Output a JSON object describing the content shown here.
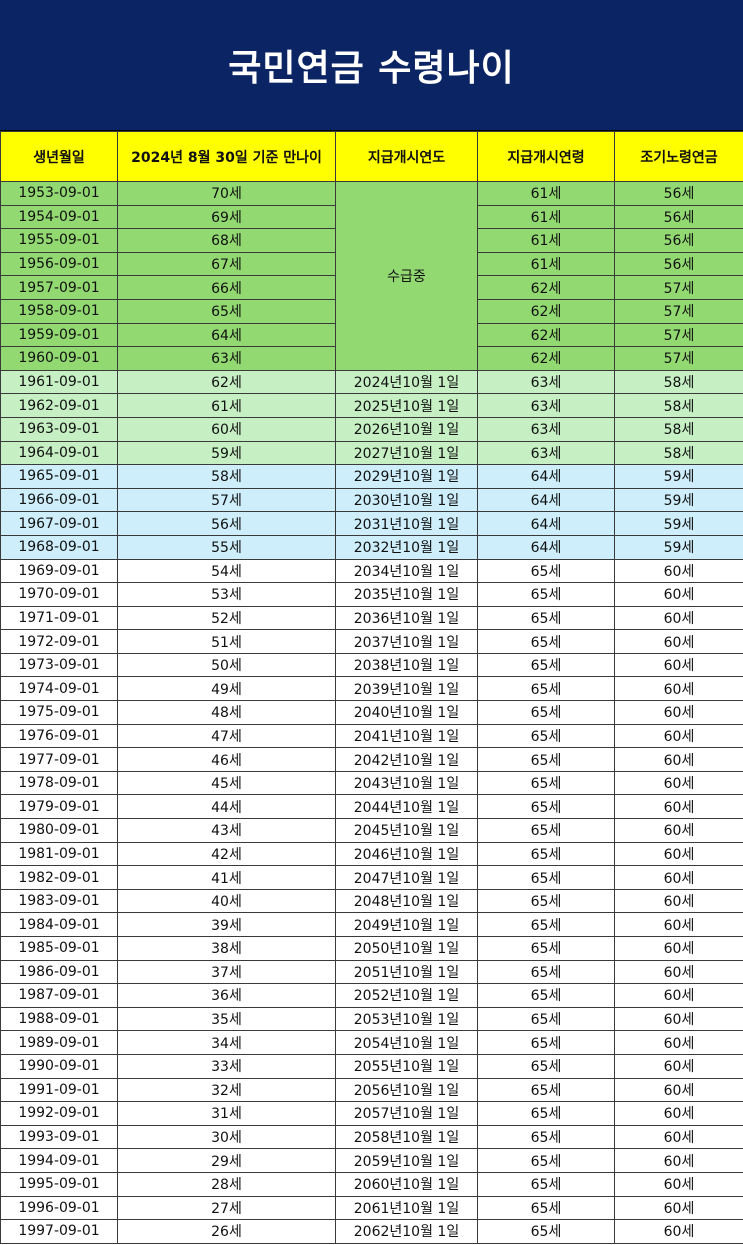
{
  "title": "국민연금 수령나이",
  "colors": {
    "title_bg": "#0b2463",
    "header_bg": "#ffff00",
    "group_receiving": "#92d972",
    "group_63": "#c6efc4",
    "group_64": "#cdeefa",
    "group_65": "#ffffff"
  },
  "table": {
    "headers": [
      "생년월일",
      "2024년 8월 30일 기준 만나이",
      "지급개시연도",
      "지급개시연령",
      "조기노령연금"
    ],
    "merged_status": "수급중",
    "rows": [
      {
        "birth": "1953-09-01",
        "age": "70세",
        "start_year": "",
        "start_age": "61세",
        "early": "56세",
        "group": "g1"
      },
      {
        "birth": "1954-09-01",
        "age": "69세",
        "start_year": "",
        "start_age": "61세",
        "early": "56세",
        "group": "g1"
      },
      {
        "birth": "1955-09-01",
        "age": "68세",
        "start_year": "",
        "start_age": "61세",
        "early": "56세",
        "group": "g1"
      },
      {
        "birth": "1956-09-01",
        "age": "67세",
        "start_year": "",
        "start_age": "61세",
        "early": "56세",
        "group": "g1"
      },
      {
        "birth": "1957-09-01",
        "age": "66세",
        "start_year": "",
        "start_age": "62세",
        "early": "57세",
        "group": "g1"
      },
      {
        "birth": "1958-09-01",
        "age": "65세",
        "start_year": "",
        "start_age": "62세",
        "early": "57세",
        "group": "g1"
      },
      {
        "birth": "1959-09-01",
        "age": "64세",
        "start_year": "",
        "start_age": "62세",
        "early": "57세",
        "group": "g1"
      },
      {
        "birth": "1960-09-01",
        "age": "63세",
        "start_year": "",
        "start_age": "62세",
        "early": "57세",
        "group": "g1"
      },
      {
        "birth": "1961-09-01",
        "age": "62세",
        "start_year": "2024년10월 1일",
        "start_age": "63세",
        "early": "58세",
        "group": "g2"
      },
      {
        "birth": "1962-09-01",
        "age": "61세",
        "start_year": "2025년10월 1일",
        "start_age": "63세",
        "early": "58세",
        "group": "g2"
      },
      {
        "birth": "1963-09-01",
        "age": "60세",
        "start_year": "2026년10월 1일",
        "start_age": "63세",
        "early": "58세",
        "group": "g2"
      },
      {
        "birth": "1964-09-01",
        "age": "59세",
        "start_year": "2027년10월 1일",
        "start_age": "63세",
        "early": "58세",
        "group": "g2"
      },
      {
        "birth": "1965-09-01",
        "age": "58세",
        "start_year": "2029년10월 1일",
        "start_age": "64세",
        "early": "59세",
        "group": "g3"
      },
      {
        "birth": "1966-09-01",
        "age": "57세",
        "start_year": "2030년10월 1일",
        "start_age": "64세",
        "early": "59세",
        "group": "g3"
      },
      {
        "birth": "1967-09-01",
        "age": "56세",
        "start_year": "2031년10월 1일",
        "start_age": "64세",
        "early": "59세",
        "group": "g3"
      },
      {
        "birth": "1968-09-01",
        "age": "55세",
        "start_year": "2032년10월 1일",
        "start_age": "64세",
        "early": "59세",
        "group": "g3"
      },
      {
        "birth": "1969-09-01",
        "age": "54세",
        "start_year": "2034년10월 1일",
        "start_age": "65세",
        "early": "60세",
        "group": "g4"
      },
      {
        "birth": "1970-09-01",
        "age": "53세",
        "start_year": "2035년10월 1일",
        "start_age": "65세",
        "early": "60세",
        "group": "g4"
      },
      {
        "birth": "1971-09-01",
        "age": "52세",
        "start_year": "2036년10월 1일",
        "start_age": "65세",
        "early": "60세",
        "group": "g4"
      },
      {
        "birth": "1972-09-01",
        "age": "51세",
        "start_year": "2037년10월 1일",
        "start_age": "65세",
        "early": "60세",
        "group": "g4"
      },
      {
        "birth": "1973-09-01",
        "age": "50세",
        "start_year": "2038년10월 1일",
        "start_age": "65세",
        "early": "60세",
        "group": "g4"
      },
      {
        "birth": "1974-09-01",
        "age": "49세",
        "start_year": "2039년10월 1일",
        "start_age": "65세",
        "early": "60세",
        "group": "g4"
      },
      {
        "birth": "1975-09-01",
        "age": "48세",
        "start_year": "2040년10월 1일",
        "start_age": "65세",
        "early": "60세",
        "group": "g4"
      },
      {
        "birth": "1976-09-01",
        "age": "47세",
        "start_year": "2041년10월 1일",
        "start_age": "65세",
        "early": "60세",
        "group": "g4"
      },
      {
        "birth": "1977-09-01",
        "age": "46세",
        "start_year": "2042년10월 1일",
        "start_age": "65세",
        "early": "60세",
        "group": "g4"
      },
      {
        "birth": "1978-09-01",
        "age": "45세",
        "start_year": "2043년10월 1일",
        "start_age": "65세",
        "early": "60세",
        "group": "g4"
      },
      {
        "birth": "1979-09-01",
        "age": "44세",
        "start_year": "2044년10월 1일",
        "start_age": "65세",
        "early": "60세",
        "group": "g4"
      },
      {
        "birth": "1980-09-01",
        "age": "43세",
        "start_year": "2045년10월 1일",
        "start_age": "65세",
        "early": "60세",
        "group": "g4"
      },
      {
        "birth": "1981-09-01",
        "age": "42세",
        "start_year": "2046년10월 1일",
        "start_age": "65세",
        "early": "60세",
        "group": "g4"
      },
      {
        "birth": "1982-09-01",
        "age": "41세",
        "start_year": "2047년10월 1일",
        "start_age": "65세",
        "early": "60세",
        "group": "g4"
      },
      {
        "birth": "1983-09-01",
        "age": "40세",
        "start_year": "2048년10월 1일",
        "start_age": "65세",
        "early": "60세",
        "group": "g4"
      },
      {
        "birth": "1984-09-01",
        "age": "39세",
        "start_year": "2049년10월 1일",
        "start_age": "65세",
        "early": "60세",
        "group": "g4"
      },
      {
        "birth": "1985-09-01",
        "age": "38세",
        "start_year": "2050년10월 1일",
        "start_age": "65세",
        "early": "60세",
        "group": "g4"
      },
      {
        "birth": "1986-09-01",
        "age": "37세",
        "start_year": "2051년10월 1일",
        "start_age": "65세",
        "early": "60세",
        "group": "g4"
      },
      {
        "birth": "1987-09-01",
        "age": "36세",
        "start_year": "2052년10월 1일",
        "start_age": "65세",
        "early": "60세",
        "group": "g4"
      },
      {
        "birth": "1988-09-01",
        "age": "35세",
        "start_year": "2053년10월 1일",
        "start_age": "65세",
        "early": "60세",
        "group": "g4"
      },
      {
        "birth": "1989-09-01",
        "age": "34세",
        "start_year": "2054년10월 1일",
        "start_age": "65세",
        "early": "60세",
        "group": "g4"
      },
      {
        "birth": "1990-09-01",
        "age": "33세",
        "start_year": "2055년10월 1일",
        "start_age": "65세",
        "early": "60세",
        "group": "g4"
      },
      {
        "birth": "1991-09-01",
        "age": "32세",
        "start_year": "2056년10월 1일",
        "start_age": "65세",
        "early": "60세",
        "group": "g4"
      },
      {
        "birth": "1992-09-01",
        "age": "31세",
        "start_year": "2057년10월 1일",
        "start_age": "65세",
        "early": "60세",
        "group": "g4"
      },
      {
        "birth": "1993-09-01",
        "age": "30세",
        "start_year": "2058년10월 1일",
        "start_age": "65세",
        "early": "60세",
        "group": "g4"
      },
      {
        "birth": "1994-09-01",
        "age": "29세",
        "start_year": "2059년10월 1일",
        "start_age": "65세",
        "early": "60세",
        "group": "g4"
      },
      {
        "birth": "1995-09-01",
        "age": "28세",
        "start_year": "2060년10월 1일",
        "start_age": "65세",
        "early": "60세",
        "group": "g4"
      },
      {
        "birth": "1996-09-01",
        "age": "27세",
        "start_year": "2061년10월 1일",
        "start_age": "65세",
        "early": "60세",
        "group": "g4"
      },
      {
        "birth": "1997-09-01",
        "age": "26세",
        "start_year": "2062년10월 1일",
        "start_age": "65세",
        "early": "60세",
        "group": "g4"
      }
    ]
  }
}
